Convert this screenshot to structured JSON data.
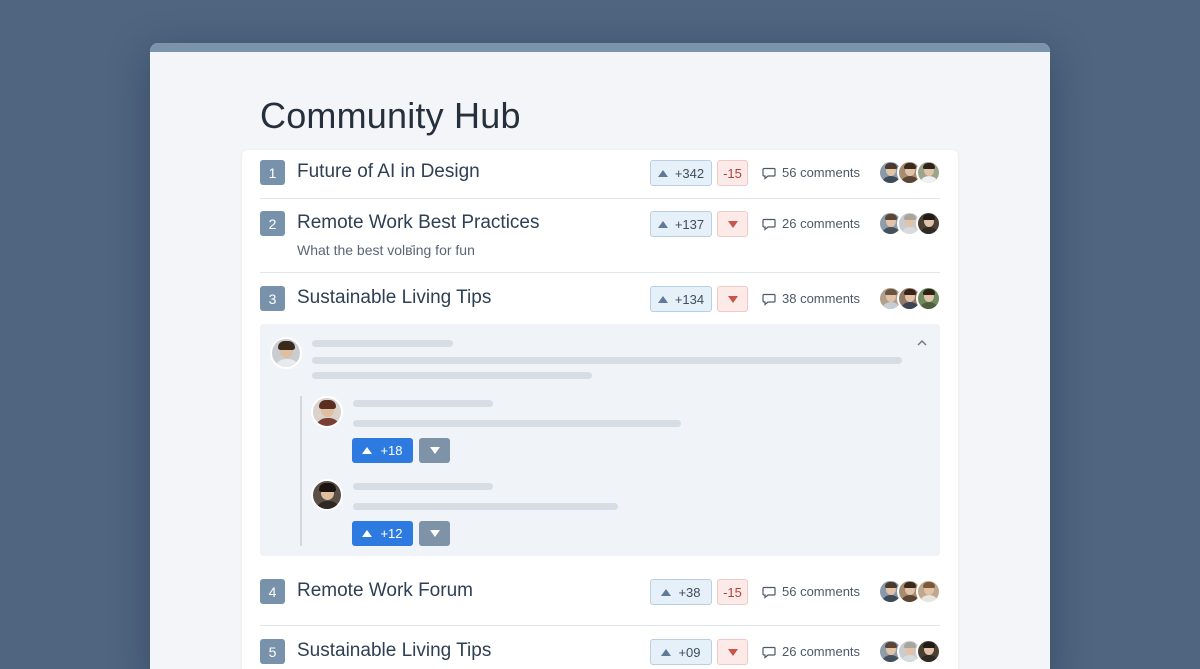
{
  "page": {
    "title": "Community Hub"
  },
  "colors": {
    "background": "#4f6580",
    "accent": "#2d7be0",
    "upvote_bg": "#e6f0f9",
    "downvote_bg": "#fbeae8",
    "badge": "#7892ab"
  },
  "posts": [
    {
      "rank": "1",
      "title": "Future of AI in Design",
      "subtitle": "",
      "upvotes": "+342",
      "downvotes": "-15",
      "comments": "56 comments"
    },
    {
      "rank": "2",
      "title": "Remote Work Best Practices",
      "subtitle": "What the best volв̄ing for fun",
      "upvotes": "+137",
      "downvotes": "",
      "comments": "26 comments"
    },
    {
      "rank": "3",
      "title": "Sustainable Living Tips",
      "subtitle": "",
      "upvotes": "+134",
      "downvotes": "",
      "comments": "38 comments"
    },
    {
      "rank": "4",
      "title": "Remote Work Forum",
      "subtitle": "",
      "upvotes": "+38",
      "downvotes": "-15",
      "comments": "56 comments"
    },
    {
      "rank": "5",
      "title": "Sustainable Living Tips",
      "subtitle": "",
      "upvotes": "+09",
      "downvotes": "",
      "comments": "26 comments"
    }
  ],
  "thread": {
    "replies": [
      {
        "upvotes": "+18"
      },
      {
        "upvotes": "+12"
      }
    ]
  },
  "icons": {
    "upvote": "triangle-up-icon",
    "downvote": "triangle-down-icon",
    "comments": "speech-bubble-icon",
    "collapse": "chevron-up-icon"
  }
}
